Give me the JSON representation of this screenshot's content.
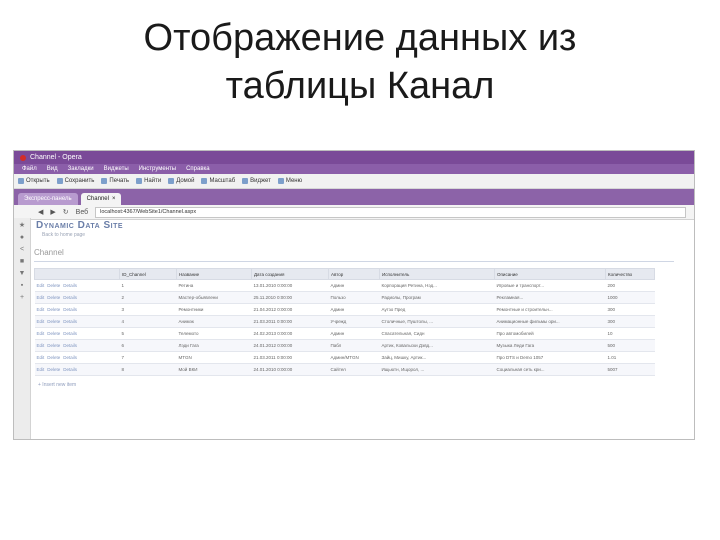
{
  "slide": {
    "title_line1": "Отображение данных из",
    "title_line2": "таблицы Канал"
  },
  "browser": {
    "window_title": "Channel - Opera",
    "menu": [
      "Файл",
      "Вид",
      "Закладки",
      "Виджеты",
      "Инструменты",
      "Справка"
    ],
    "bookmarks": [
      "Открыть",
      "Сохранить",
      "Печать",
      "Найти",
      "Домой",
      "Масштаб",
      "Виджет",
      "Меню"
    ],
    "tabs": [
      {
        "label": "Экспресс-панель"
      },
      {
        "label": "Channel"
      }
    ],
    "address": "localhost:4367/WebSite1/Channel.aspx",
    "address_label": "Веб"
  },
  "page": {
    "site_title": "Dynamic Data Site",
    "back_link": "Back to home page",
    "section_title": "Channel",
    "insert_link": "+ Insert new item",
    "row_actions": [
      "Edit",
      "Delete",
      "Details"
    ],
    "columns": [
      "",
      "ID_Channel",
      "Название",
      "Дата создания",
      "Автор",
      "Исполнитель",
      "Описание",
      "Количество"
    ],
    "rows": [
      [
        "1",
        "Ретина",
        "13.01.2010 0:00:00",
        "Админ",
        "Корпорация Ретина, Нэд...",
        "Игровые и транспорт...",
        "200"
      ],
      [
        "2",
        "Мастер-обьявлени",
        "25.11.2010 0:00:00",
        "Пользо",
        "Радиолы, Програм",
        "Рекламная...",
        "1000"
      ],
      [
        "3",
        "Ремонтники",
        "21.04.2012 0:00:00",
        "Админ",
        "Аутзо Пред",
        "Ремонтные и строительн...",
        "300"
      ],
      [
        "4",
        "Анимэк",
        "21.03.2011 0:00:00",
        "Учрежд",
        "Столичные, Пуштолы, ...",
        "Анимационные фильмы ори...",
        "300"
      ],
      [
        "5",
        "Телемото",
        "24.02.2013 0:00:00",
        "Админ",
        "Спасательная, Сидн",
        "Про автомобилей",
        "10"
      ],
      [
        "6",
        "Лэди Гага",
        "24.01.2012 0:00:00",
        "Пабл",
        "Артик, Ковальски Дэвд...",
        "Музыка Леди Гага",
        "500"
      ],
      [
        "7",
        "MTGN",
        "21.03.2011 0:00:00",
        "Админ/MTGN",
        "Зайц, Мишку, Артик...",
        "Про DTS и Demo 1057",
        "1.01"
      ],
      [
        "8",
        "Мой ВКИ",
        "24.01.2010 0:00:00",
        "Сайтел",
        "Ищьютн, Ищорол, ...",
        "Социальная сеть кри...",
        "5007"
      ]
    ]
  }
}
